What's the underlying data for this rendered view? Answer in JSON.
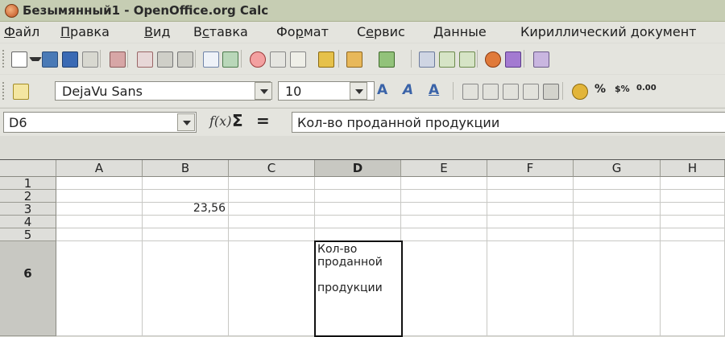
{
  "window": {
    "title": "Безымянный1 - OpenOffice.org Calc"
  },
  "menu": [
    {
      "pre": "",
      "ul": "Ф",
      "post": "айл"
    },
    {
      "pre": "",
      "ul": "П",
      "post": "равка"
    },
    {
      "pre": "",
      "ul": "В",
      "post": "ид"
    },
    {
      "pre": "В",
      "ul": "с",
      "post": "тавка"
    },
    {
      "pre": "Фо",
      "ul": "р",
      "post": "мат"
    },
    {
      "pre": "С",
      "ul": "е",
      "post": "рвис"
    },
    {
      "pre": "",
      "ul": "Д",
      "post": "анные"
    },
    {
      "pre": "Кириллический документ",
      "ul": "",
      "post": ""
    }
  ],
  "formatting": {
    "font_name": "DejaVu Sans",
    "font_size": "10"
  },
  "formula_bar": {
    "cell_ref": "D6",
    "content": "Кол-во проданной продукции"
  },
  "sheet": {
    "columns": [
      "A",
      "B",
      "C",
      "D",
      "E",
      "F",
      "G",
      "H"
    ],
    "rows": [
      "1",
      "2",
      "3",
      "4",
      "5",
      "6"
    ],
    "cells": {
      "B3": "23,56",
      "D6": "Кол-во\nпроданной\n\nпродукции"
    },
    "active_cell": "D6"
  }
}
